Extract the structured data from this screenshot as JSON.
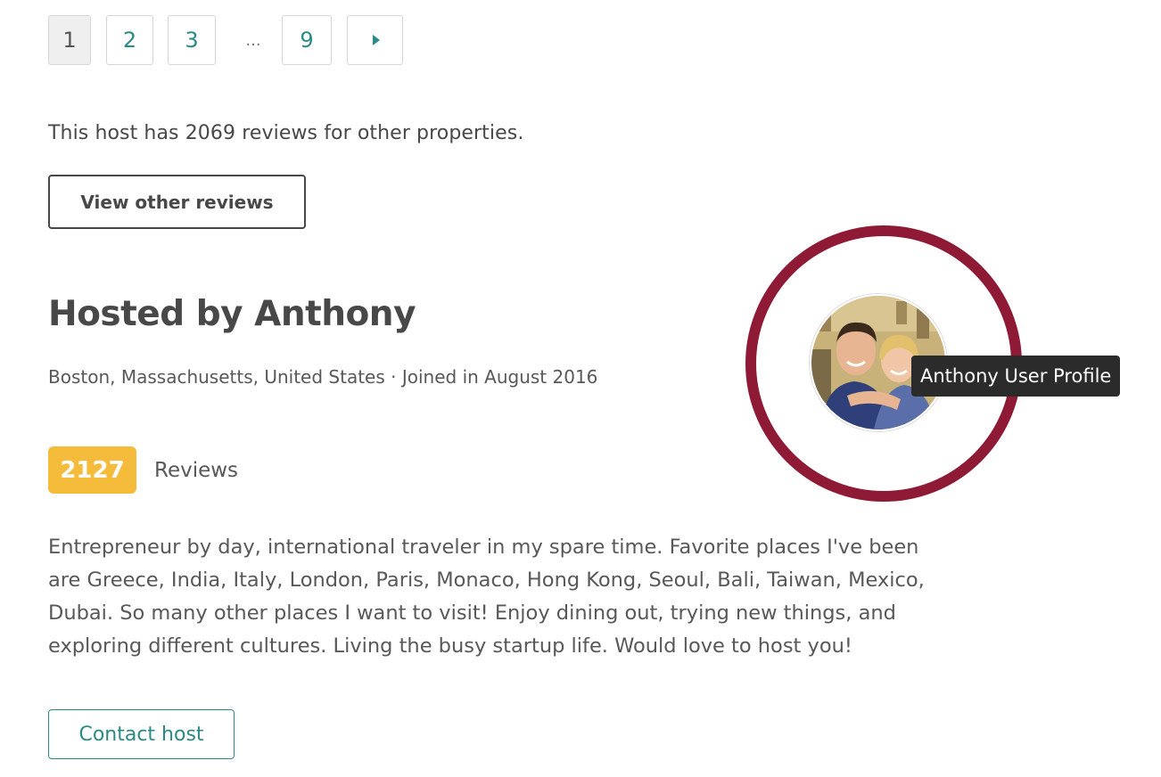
{
  "pagination": {
    "pages": [
      "1",
      "2",
      "3",
      "9"
    ],
    "current": "1",
    "ellipsis": "...",
    "next_icon": "chevron-right-icon"
  },
  "other_reviews": {
    "text": "This host has 2069 reviews for other properties.",
    "button_label": "View other reviews"
  },
  "host": {
    "title": "Hosted by Anthony",
    "location": "Boston, Massachusetts, United States · Joined in August 2016",
    "review_count": "2127",
    "reviews_label": "Reviews",
    "bio": "Entrepreneur by day, international traveler in my spare time. Favorite places I've been are Greece, India, Italy, London, Paris, Monaco, Hong Kong, Seoul, Bali, Taiwan, Mexico, Dubai. So many other places I want to visit! Enjoy dining out, trying new things, and exploring different cultures. Living the busy startup life. Would love to host you!",
    "contact_label": "Contact host",
    "avatar_tooltip": "Anthony User Profile"
  },
  "colors": {
    "teal_accent": "#2a8a86",
    "badge_yellow": "#f5bc3b",
    "highlight_ring": "#8e1a36",
    "text_dark": "#484848"
  }
}
